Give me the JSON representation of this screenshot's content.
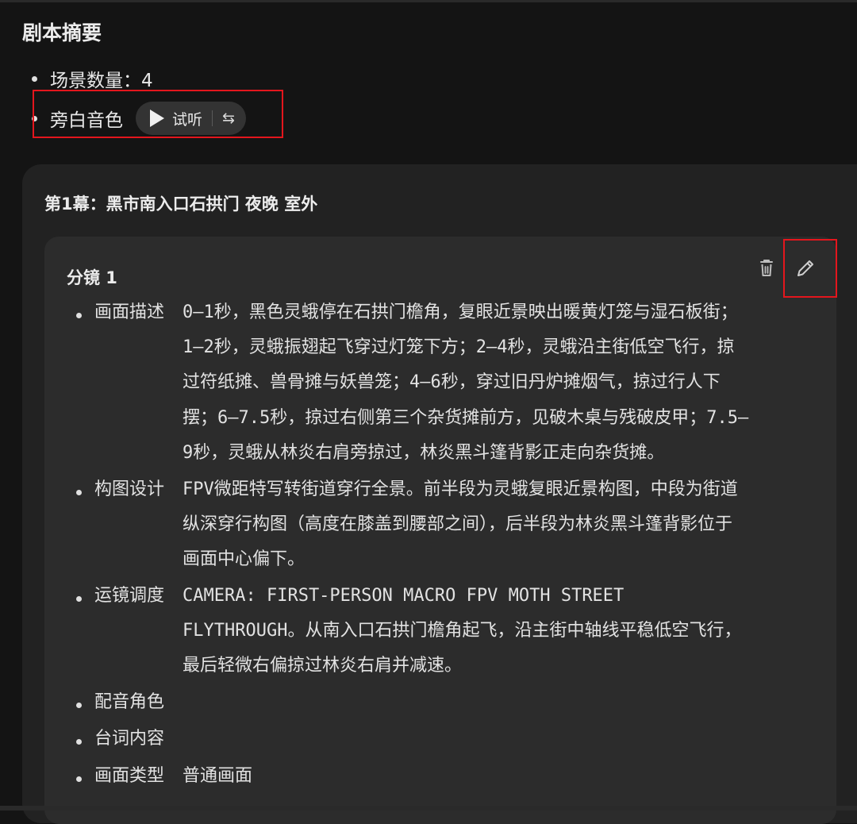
{
  "header": {
    "title": "剧本摘要"
  },
  "summary": {
    "scene_count_label": "场景数量：4",
    "narrator_label": "旁白音色",
    "preview_label": "试听",
    "swap_glyph": "⇆"
  },
  "scene": {
    "title": "第1幕：黑市南入口石拱门 夜晚 室外",
    "shot": {
      "title": "分镜 1",
      "fields": [
        {
          "label": "画面描述",
          "lines": [
            "0–1秒，黑色灵蛾停在石拱门檐角，复眼近景映出暖黄灯笼与湿石板街；",
            "1–2秒，灵蛾振翅起飞穿过灯笼下方；2–4秒，灵蛾沿主街低空飞行，掠",
            "过符纸摊、兽骨摊与妖兽笼；4–6秒，穿过旧丹炉摊烟气，掠过行人下",
            "摆；6–7.5秒，掠过右侧第三个杂货摊前方，见破木桌与残破皮甲；7.5–",
            "9秒，灵蛾从林炎右肩旁掠过，林炎黑斗篷背影正走向杂货摊。"
          ]
        },
        {
          "label": "构图设计",
          "lines": [
            "FPV微距特写转街道穿行全景。前半段为灵蛾复眼近景构图，中段为街道",
            "纵深穿行构图（高度在膝盖到腰部之间），后半段为林炎黑斗篷背影位于",
            "画面中心偏下。"
          ]
        },
        {
          "label": "运镜调度",
          "lines": [
            "CAMERA: FIRST-PERSON MACRO FPV MOTH STREET",
            "FLYTHROUGH。从南入口石拱门檐角起飞，沿主街中轴线平稳低空飞行，",
            "最后轻微右偏掠过林炎右肩并减速。"
          ]
        },
        {
          "label": "配音角色",
          "lines": []
        },
        {
          "label": "台词内容",
          "lines": []
        },
        {
          "label": "画面类型",
          "lines": [
            "普通画面"
          ]
        }
      ]
    }
  },
  "colors": {
    "background": "#141414",
    "scene_card": "#222222",
    "shot_card": "#2c2c2c",
    "highlight": "#e4161d",
    "pill": "#333333"
  },
  "icons": {
    "play": "play-icon",
    "swap": "swap-icon",
    "delete": "trash-icon",
    "edit": "pencil-icon"
  }
}
